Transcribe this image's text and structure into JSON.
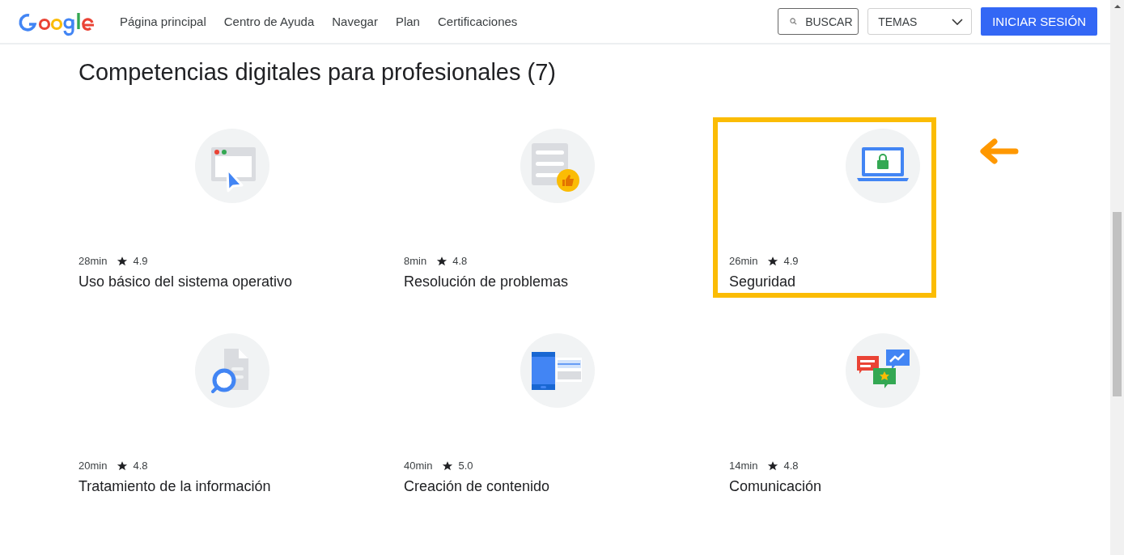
{
  "header": {
    "nav": [
      "Página principal",
      "Centro de Ayuda",
      "Navegar",
      "Plan",
      "Certificaciones"
    ],
    "search_button": "BUSCAR",
    "topics_select": "TEMAS",
    "signin_button": "INICIAR SESIÓN"
  },
  "section": {
    "title": "Competencias digitales para profesionales (7)"
  },
  "courses": [
    {
      "kind": "browser",
      "duration": "28min",
      "rating": "4.9",
      "title": "Uso básico del sistema operativo",
      "highlighted": false
    },
    {
      "kind": "document",
      "duration": "8min",
      "rating": "4.8",
      "title": "Resolución de problemas",
      "highlighted": false
    },
    {
      "kind": "laptop",
      "duration": "26min",
      "rating": "4.9",
      "title": "Seguridad",
      "highlighted": true
    },
    {
      "kind": "search",
      "duration": "20min",
      "rating": "4.8",
      "title": "Tratamiento de la información",
      "highlighted": false
    },
    {
      "kind": "phone",
      "duration": "40min",
      "rating": "5.0",
      "title": "Creación de contenido",
      "highlighted": false
    },
    {
      "kind": "chat",
      "duration": "14min",
      "rating": "4.8",
      "title": "Comunicación",
      "highlighted": false
    }
  ]
}
